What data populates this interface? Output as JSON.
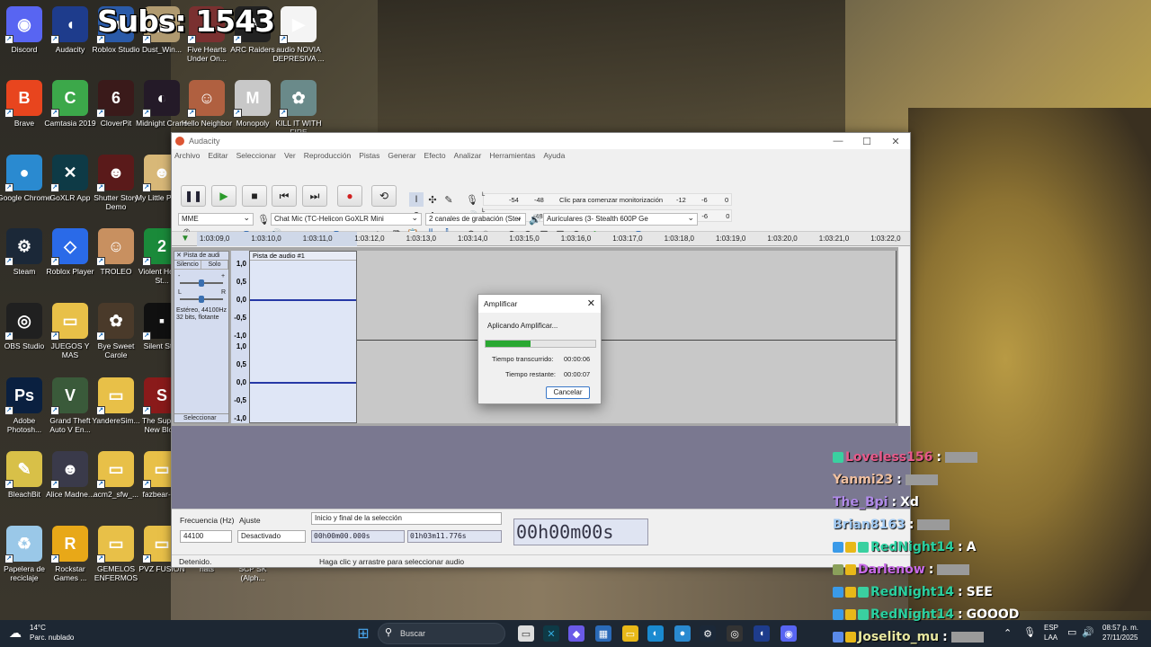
{
  "overlay": {
    "subs": "Subs: 1543"
  },
  "desktop_icons": [
    {
      "label": "Discord",
      "color": "#5865f2",
      "glyph": "◉"
    },
    {
      "label": "Audacity",
      "color": "#1e3c8c",
      "glyph": "◖"
    },
    {
      "label": "Roblox Studio",
      "color": "#2a5aa8",
      "glyph": "■"
    },
    {
      "label": "Dust_Win...",
      "color": "#b09a70",
      "glyph": "▤"
    },
    {
      "label": "Five Hearts Under On...",
      "color": "#7a3030",
      "glyph": "♥"
    },
    {
      "label": "ARC Raiders",
      "color": "#222222",
      "glyph": "A"
    },
    {
      "label": "audio NOVIA DEPRESIVA ...",
      "color": "#f4f4f4",
      "glyph": "▶"
    },
    {
      "label": "Brave",
      "color": "#e8451e",
      "glyph": "B"
    },
    {
      "label": "Camtasia 2019",
      "color": "#3ca84a",
      "glyph": "C"
    },
    {
      "label": "CloverPit",
      "color": "#3a1a1a",
      "glyph": "6"
    },
    {
      "label": "Midnight Crane",
      "color": "#241a28",
      "glyph": "◐"
    },
    {
      "label": "Hello Neighbor",
      "color": "#b06040",
      "glyph": "☺"
    },
    {
      "label": "Monopoly",
      "color": "#c8c8c8",
      "glyph": "M"
    },
    {
      "label": "KILL IT WITH FIRE",
      "color": "#6a8a8a",
      "glyph": "✿"
    },
    {
      "label": "Google Chrome",
      "color": "#2a8ad0",
      "glyph": "●"
    },
    {
      "label": "GoXLR App",
      "color": "#0e3a46",
      "glyph": "✕"
    },
    {
      "label": "Shutter Story Demo",
      "color": "#5a1a1a",
      "glyph": "☻"
    },
    {
      "label": "My Little Puppy",
      "color": "#d8b878",
      "glyph": "☻"
    },
    {
      "label": "Steam",
      "color": "#1b2838",
      "glyph": "⚙"
    },
    {
      "label": "Roblox Player",
      "color": "#2a6ae8",
      "glyph": "◇"
    },
    {
      "label": "TROLEO",
      "color": "#c89060",
      "glyph": "☺"
    },
    {
      "label": "Violent Horror St...",
      "color": "#1a8a3a",
      "glyph": "2"
    },
    {
      "label": "OBS Studio",
      "color": "#202020",
      "glyph": "◎"
    },
    {
      "label": "JUEGOS Y MAS",
      "color": "#e8c048",
      "glyph": "▭"
    },
    {
      "label": "Bye Sweet Carole",
      "color": "#4a3a2a",
      "glyph": "✿"
    },
    {
      "label": "Silent Sti...",
      "color": "#101010",
      "glyph": "▪"
    },
    {
      "label": "Adobe Photosh...",
      "color": "#0a2040",
      "glyph": "Ps"
    },
    {
      "label": "Grand Theft Auto V En...",
      "color": "#3a5a3a",
      "glyph": "V"
    },
    {
      "label": "YandereSim...",
      "color": "#e8c048",
      "glyph": "▭"
    },
    {
      "label": "The Supp... New Blo...",
      "color": "#8a1a1a",
      "glyph": "S"
    },
    {
      "label": "BleachBit",
      "color": "#d8c048",
      "glyph": "✎"
    },
    {
      "label": "Alice Madne...",
      "color": "#3a3a4a",
      "glyph": "☻"
    },
    {
      "label": "acm2_sfw_...",
      "color": "#e8c048",
      "glyph": "▭"
    },
    {
      "label": "fazbear-n...",
      "color": "#e8c048",
      "glyph": "▭"
    },
    {
      "label": "Papelera de reciclaje",
      "color": "#9ac8e8",
      "glyph": "♻"
    },
    {
      "label": "Rockstar Games ...",
      "color": "#e8a818",
      "glyph": "R"
    },
    {
      "label": "GEMELOS ENFERMOS",
      "color": "#e8c048",
      "glyph": "▭"
    },
    {
      "label": "PVZ FUSION",
      "color": "#e8c048",
      "glyph": "▭"
    },
    {
      "label": "nats",
      "color": "#555555",
      "glyph": "▪"
    },
    {
      "label": "SCP SK (Alph...",
      "color": "#555555",
      "glyph": "▪"
    }
  ],
  "audacity": {
    "title": "Audacity",
    "menu": [
      "Archivo",
      "Editar",
      "Seleccionar",
      "Ver",
      "Reproducción",
      "Pistas",
      "Generar",
      "Efecto",
      "Analizar",
      "Herramientas",
      "Ayuda"
    ],
    "meter_rec_ticks": [
      "-54",
      "-48",
      "-12",
      "-6",
      "0"
    ],
    "meter_rec_hint": "Clic para comenzar monitorización",
    "meter_play_ticks": [
      "-54",
      "-48",
      "-42",
      "-36",
      "-30",
      "-24",
      "-18",
      "-12",
      "-6",
      "0"
    ],
    "meter_rl": [
      "L",
      "R"
    ],
    "host": "MME",
    "rec_device": "Chat Mic (TC-Helicon GoXLR Mini",
    "channels": "2 canales de grabación (Ster",
    "play_device": "Auriculares (3- Stealth 600P Ge",
    "timeline": [
      "1:03:09,0",
      "1:03:10,0",
      "1:03:11,0",
      "1:03:12,0",
      "1:03:13,0",
      "1:03:14,0",
      "1:03:15,0",
      "1:03:16,0",
      "1:03:17,0",
      "1:03:18,0",
      "1:03:19,0",
      "1:03:20,0",
      "1:03:21,0",
      "1:03:22,0"
    ],
    "track": {
      "name": "Pista de audi",
      "clip": "Pista de audio #1",
      "mute": "Silencio",
      "solo": "Solo",
      "info1": "Estéreo, 44100Hz",
      "info2": "32 bits, flotante",
      "select": "Seleccionar",
      "pan_l": "L",
      "pan_r": "R",
      "gain_minus": "-",
      "gain_plus": "+",
      "y_ticks": [
        "1,0",
        "0,5",
        "0,0",
        "-0,5",
        "-1,0"
      ]
    },
    "selection": {
      "freq_label": "Frecuencia (Hz)",
      "freq_value": "44100",
      "snap_label": "Ajuste",
      "snap_value": "Desactivado",
      "mode": "Inicio y final de la selección",
      "start": "00h00m00.000s",
      "end": "01h03m11.776s",
      "big_time": "00h00m00s"
    },
    "status_left": "Detenido.",
    "status_mid": "Haga clic y arrastre para seleccionar audio"
  },
  "dialog": {
    "title": "Amplificar",
    "message": "Aplicando Amplificar...",
    "progress": 0.41,
    "elapsed_label": "Tiempo transcurrido:",
    "elapsed": "00:00:06",
    "remaining_label": "Tiempo restante:",
    "remaining": "00:00:07",
    "cancel": "Cancelar"
  },
  "chat": [
    {
      "user": "Loveless156",
      "color": "#e85a8a",
      "text": "",
      "emote": true,
      "badges": [
        "#3ad0a0"
      ]
    },
    {
      "user": "Yanmi23",
      "color": "#f0c0a0",
      "text": "",
      "emote": true,
      "badges": []
    },
    {
      "user": "The_Bpi",
      "color": "#b08ae8",
      "text": "Xd",
      "emote": false,
      "badges": []
    },
    {
      "user": "Brian8163",
      "color": "#a0c8f0",
      "text": "",
      "emote": true,
      "badges": []
    },
    {
      "user": "RedNight14",
      "color": "#2ad0a0",
      "text": "A",
      "emote": false,
      "badges": [
        "#3a9ae8",
        "#e8b818",
        "#3ad0a0"
      ]
    },
    {
      "user": "Darlenow",
      "color": "#c86ae8",
      "text": "",
      "emote": true,
      "badges": [
        "#8aa05a",
        "#e8b818"
      ]
    },
    {
      "user": "RedNight14",
      "color": "#2ad0a0",
      "text": "SEE",
      "emote": false,
      "badges": [
        "#3a9ae8",
        "#e8b818",
        "#3ad0a0"
      ]
    },
    {
      "user": "RedNight14",
      "color": "#2ad0a0",
      "text": "GOOOD",
      "emote": false,
      "badges": [
        "#3a9ae8",
        "#e8b818",
        "#3ad0a0"
      ]
    },
    {
      "user": "Joselito_mu",
      "color": "#e8e8a0",
      "text": "",
      "emote": true,
      "badges": [
        "#5a8ae8",
        "#e8b818"
      ]
    }
  ],
  "taskbar": {
    "weather_temp": "14°C",
    "weather_desc": "Parc. nublado",
    "search": "Buscar",
    "lang1": "ESP",
    "lang2": "LAA",
    "time": "08:57 p. m.",
    "date": "27/11/2025"
  }
}
